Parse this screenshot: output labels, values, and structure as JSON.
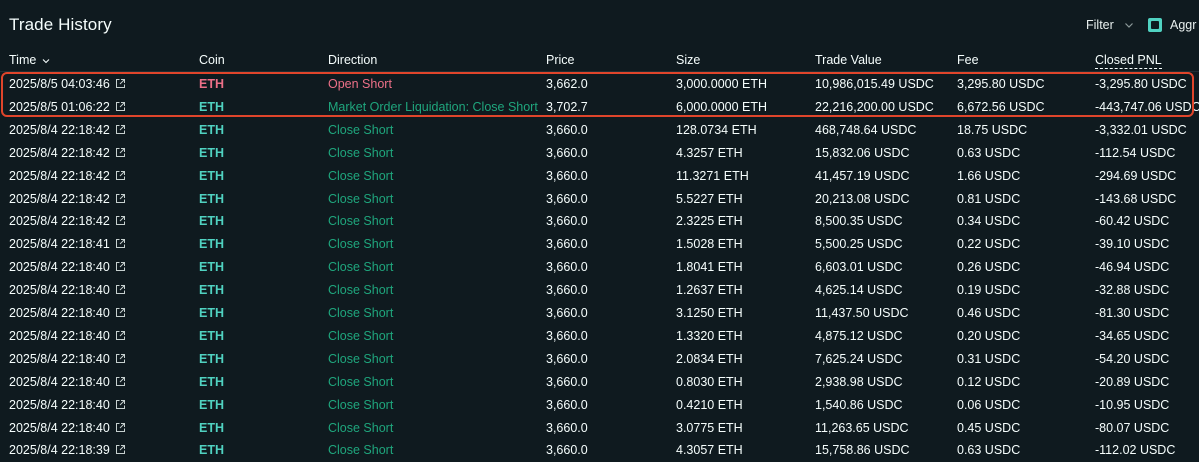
{
  "header": {
    "title": "Trade History",
    "filter_label": "Filter",
    "aggregate_label": "Aggr"
  },
  "columns": {
    "time": "Time",
    "coin": "Coin",
    "direction": "Direction",
    "price": "Price",
    "size": "Size",
    "trade_value": "Trade Value",
    "fee": "Fee",
    "closed_pnl": "Closed PNL"
  },
  "colors": {
    "background": "#0f1a1f",
    "short_red": "#ed7088",
    "long_green": "#1fa67d",
    "accent_teal": "#50d2c1",
    "highlight_border": "#e0452b"
  },
  "rows": [
    {
      "time": "2025/8/5 04:03:46",
      "coin": "ETH",
      "coin_side": "short",
      "direction": "Open Short",
      "dir_side": "short",
      "price": "3,662.0",
      "size": "3,000.0000 ETH",
      "trade_value": "10,986,015.49 USDC",
      "fee": "3,295.80 USDC",
      "pnl": "-3,295.80 USDC"
    },
    {
      "time": "2025/8/5 01:06:22",
      "coin": "ETH",
      "coin_side": "long",
      "direction": "Market Order Liquidation: Close Short",
      "dir_side": "long",
      "price": "3,702.7",
      "size": "6,000.0000 ETH",
      "trade_value": "22,216,200.00 USDC",
      "fee": "6,672.56 USDC",
      "pnl": "-443,747.06 USDC"
    },
    {
      "time": "2025/8/4 22:18:42",
      "coin": "ETH",
      "coin_side": "long",
      "direction": "Close Short",
      "dir_side": "long",
      "price": "3,660.0",
      "size": "128.0734 ETH",
      "trade_value": "468,748.64 USDC",
      "fee": "18.75 USDC",
      "pnl": "-3,332.01 USDC"
    },
    {
      "time": "2025/8/4 22:18:42",
      "coin": "ETH",
      "coin_side": "long",
      "direction": "Close Short",
      "dir_side": "long",
      "price": "3,660.0",
      "size": "4.3257 ETH",
      "trade_value": "15,832.06 USDC",
      "fee": "0.63 USDC",
      "pnl": "-112.54 USDC"
    },
    {
      "time": "2025/8/4 22:18:42",
      "coin": "ETH",
      "coin_side": "long",
      "direction": "Close Short",
      "dir_side": "long",
      "price": "3,660.0",
      "size": "11.3271 ETH",
      "trade_value": "41,457.19 USDC",
      "fee": "1.66 USDC",
      "pnl": "-294.69 USDC"
    },
    {
      "time": "2025/8/4 22:18:42",
      "coin": "ETH",
      "coin_side": "long",
      "direction": "Close Short",
      "dir_side": "long",
      "price": "3,660.0",
      "size": "5.5227 ETH",
      "trade_value": "20,213.08 USDC",
      "fee": "0.81 USDC",
      "pnl": "-143.68 USDC"
    },
    {
      "time": "2025/8/4 22:18:42",
      "coin": "ETH",
      "coin_side": "long",
      "direction": "Close Short",
      "dir_side": "long",
      "price": "3,660.0",
      "size": "2.3225 ETH",
      "trade_value": "8,500.35 USDC",
      "fee": "0.34 USDC",
      "pnl": "-60.42 USDC"
    },
    {
      "time": "2025/8/4 22:18:41",
      "coin": "ETH",
      "coin_side": "long",
      "direction": "Close Short",
      "dir_side": "long",
      "price": "3,660.0",
      "size": "1.5028 ETH",
      "trade_value": "5,500.25 USDC",
      "fee": "0.22 USDC",
      "pnl": "-39.10 USDC"
    },
    {
      "time": "2025/8/4 22:18:40",
      "coin": "ETH",
      "coin_side": "long",
      "direction": "Close Short",
      "dir_side": "long",
      "price": "3,660.0",
      "size": "1.8041 ETH",
      "trade_value": "6,603.01 USDC",
      "fee": "0.26 USDC",
      "pnl": "-46.94 USDC"
    },
    {
      "time": "2025/8/4 22:18:40",
      "coin": "ETH",
      "coin_side": "long",
      "direction": "Close Short",
      "dir_side": "long",
      "price": "3,660.0",
      "size": "1.2637 ETH",
      "trade_value": "4,625.14 USDC",
      "fee": "0.19 USDC",
      "pnl": "-32.88 USDC"
    },
    {
      "time": "2025/8/4 22:18:40",
      "coin": "ETH",
      "coin_side": "long",
      "direction": "Close Short",
      "dir_side": "long",
      "price": "3,660.0",
      "size": "3.1250 ETH",
      "trade_value": "11,437.50 USDC",
      "fee": "0.46 USDC",
      "pnl": "-81.30 USDC"
    },
    {
      "time": "2025/8/4 22:18:40",
      "coin": "ETH",
      "coin_side": "long",
      "direction": "Close Short",
      "dir_side": "long",
      "price": "3,660.0",
      "size": "1.3320 ETH",
      "trade_value": "4,875.12 USDC",
      "fee": "0.20 USDC",
      "pnl": "-34.65 USDC"
    },
    {
      "time": "2025/8/4 22:18:40",
      "coin": "ETH",
      "coin_side": "long",
      "direction": "Close Short",
      "dir_side": "long",
      "price": "3,660.0",
      "size": "2.0834 ETH",
      "trade_value": "7,625.24 USDC",
      "fee": "0.31 USDC",
      "pnl": "-54.20 USDC"
    },
    {
      "time": "2025/8/4 22:18:40",
      "coin": "ETH",
      "coin_side": "long",
      "direction": "Close Short",
      "dir_side": "long",
      "price": "3,660.0",
      "size": "0.8030 ETH",
      "trade_value": "2,938.98 USDC",
      "fee": "0.12 USDC",
      "pnl": "-20.89 USDC"
    },
    {
      "time": "2025/8/4 22:18:40",
      "coin": "ETH",
      "coin_side": "long",
      "direction": "Close Short",
      "dir_side": "long",
      "price": "3,660.0",
      "size": "0.4210 ETH",
      "trade_value": "1,540.86 USDC",
      "fee": "0.06 USDC",
      "pnl": "-10.95 USDC"
    },
    {
      "time": "2025/8/4 22:18:40",
      "coin": "ETH",
      "coin_side": "long",
      "direction": "Close Short",
      "dir_side": "long",
      "price": "3,660.0",
      "size": "3.0775 ETH",
      "trade_value": "11,263.65 USDC",
      "fee": "0.45 USDC",
      "pnl": "-80.07 USDC"
    },
    {
      "time": "2025/8/4 22:18:39",
      "coin": "ETH",
      "coin_side": "long",
      "direction": "Close Short",
      "dir_side": "long",
      "price": "3,660.0",
      "size": "4.3057 ETH",
      "trade_value": "15,758.86 USDC",
      "fee": "0.63 USDC",
      "pnl": "-112.02 USDC"
    }
  ]
}
